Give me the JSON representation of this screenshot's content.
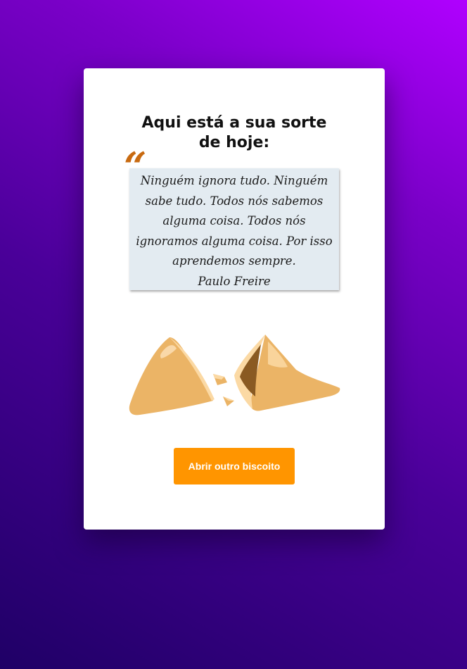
{
  "card": {
    "title_line1": "Aqui está a sua sorte",
    "title_line2": "de hoje:",
    "quote_mark": "“",
    "quote": "Ninguém ignora tudo. Ninguém sabe tudo. Todos nós sabemos alguma coisa. Todos nós ignoramos alguma coisa. Por isso aprendemos sempre.",
    "author": "Paulo Freire",
    "cookie_icon": "broken-fortune-cookie",
    "button_label": "Abrir outro biscoito"
  },
  "colors": {
    "background_start": "#1f0066",
    "background_end": "#b000ff",
    "button": "#ff9500",
    "quote_box": "#e3ebf1",
    "quote_mark": "#c86a10",
    "cookie": "#ebb466"
  }
}
